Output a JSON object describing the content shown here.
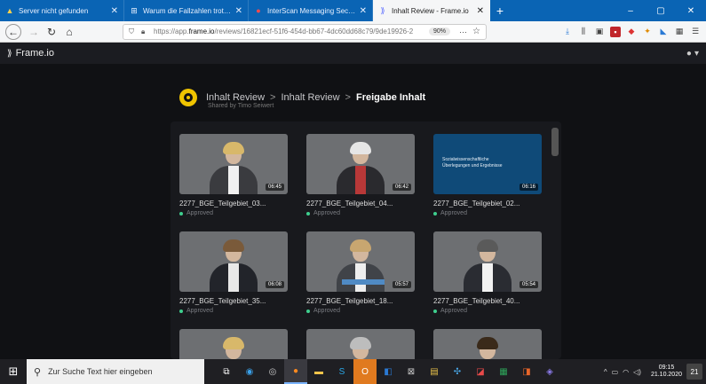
{
  "browser": {
    "tabs": [
      {
        "label": "Server nicht gefunden",
        "icon": "warning-icon",
        "active": false
      },
      {
        "label": "Warum die Fallzahlen trotz Ma",
        "icon": "page-icon",
        "active": false
      },
      {
        "label": "InterScan Messaging Security",
        "icon": "trendmicro-icon",
        "active": false
      },
      {
        "label": "Inhalt Review - Frame.io",
        "icon": "frameio-icon",
        "active": true
      }
    ],
    "new_tab": "+",
    "window": {
      "minimize": "–",
      "maximize": "▢",
      "close": "✕"
    },
    "url_prefix": "https://app.",
    "url_domain": "frame.io",
    "url_rest": "/reviews/16821ecf-51f6-454d-bb67-4dc60dd68c79/9de19926-2",
    "zoom": "90%",
    "more": "···",
    "star": "☆"
  },
  "app": {
    "brand": "Frame.io",
    "user_icon": "user-icon"
  },
  "review": {
    "crumb1": "Inhalt Review",
    "crumb2": "Inhalt Review",
    "crumb3": "Freigabe Inhalt",
    "sep": ">",
    "shared_by": "Shared by Timo Seiwert"
  },
  "assets": [
    {
      "title": "2277_BGE_Teilgebiet_03...",
      "status": "Approved",
      "duration": "06:45",
      "kind": "woman-blonde"
    },
    {
      "title": "2277_BGE_Teilgebiet_04...",
      "status": "Approved",
      "duration": "06:42",
      "kind": "woman-white"
    },
    {
      "title": "2277_BGE_Teilgebiet_02...",
      "status": "Approved",
      "duration": "06:16",
      "kind": "slide",
      "slide_text": "Sozialwissenschaftliche Überlegungen und Ergebnisse"
    },
    {
      "title": "2277_BGE_Teilgebiet_35...",
      "status": "Approved",
      "duration": "06:08",
      "kind": "man-1"
    },
    {
      "title": "2277_BGE_Teilgebiet_18...",
      "status": "Approved",
      "duration": "05:57",
      "kind": "woman-lower"
    },
    {
      "title": "2277_BGE_Teilgebiet_40...",
      "status": "Approved",
      "duration": "05:54",
      "kind": "man-2"
    },
    {
      "title": "",
      "status": "",
      "duration": "",
      "kind": "woman-blonde"
    },
    {
      "title": "",
      "status": "",
      "duration": "",
      "kind": "man-3"
    },
    {
      "title": "",
      "status": "",
      "duration": "",
      "kind": "man-4"
    }
  ],
  "taskbar": {
    "search_placeholder": "Zur Suche Text hier eingeben",
    "time": "09:15",
    "date": "21.10.2020",
    "notifications": "21"
  },
  "colors": {
    "browser_tab_bar": "#0a64b4",
    "app_bg": "#101114",
    "accent_yellow": "#f0c400",
    "approved_green": "#3ecf8e"
  }
}
